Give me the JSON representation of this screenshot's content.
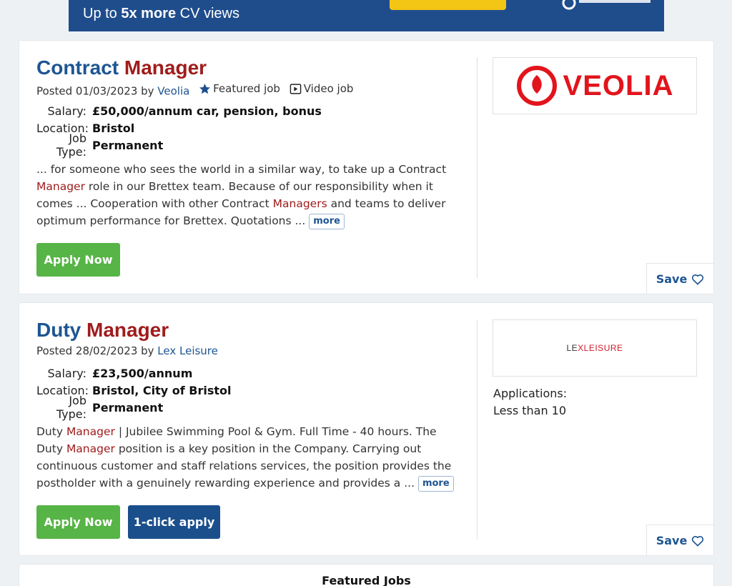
{
  "banner": {
    "text_prefix": "Up to ",
    "text_bold": "5x more",
    "text_suffix": " CV views"
  },
  "jobs": [
    {
      "title_plain": "Contract ",
      "title_highlight": "Manager",
      "posted_prefix": "Posted 01/03/2023 by ",
      "company": "Veolia",
      "featured_label": "Featured job",
      "video_label": "Video job",
      "facts": [
        {
          "label": "Salary:",
          "value": "£50,000/annum car, pension, bonus"
        },
        {
          "label": "Location:",
          "value": "Bristol"
        },
        {
          "label": "Job Type:",
          "value": "Permanent"
        }
      ],
      "desc": {
        "p1": "... for someone who sees the world in a similar way, to take up a Contract ",
        "h1": "Manager",
        "p2": " role in our Brettex team. Because of our responsibility when it comes ... Cooperation with other Contract ",
        "h2": "Managers",
        "p3": " and teams to deliver optimum performance for Brettex. Quotations ... "
      },
      "more_label": "more",
      "apply_label": "Apply Now",
      "logo_text": "VEOLIA",
      "save_label": "Save"
    },
    {
      "title_plain": "Duty ",
      "title_highlight": "Manager",
      "posted_prefix": "Posted 28/02/2023 by ",
      "company": "Lex Leisure",
      "facts": [
        {
          "label": "Salary:",
          "value": "£23,500/annum"
        },
        {
          "label": "Location:",
          "value": "Bristol, City of Bristol"
        },
        {
          "label": "Job Type:",
          "value": "Permanent"
        }
      ],
      "desc": {
        "p1": "Duty ",
        "h1": "Manager",
        "p2": " | Jubilee Swimming Pool & Gym. Full Time - 40 hours. The Duty ",
        "h2": "Manager",
        "p3": " position is a key position in the Company. Carrying out continuous customer and staff relations services, the position provides the postholder with a genuinely rewarding experience and provides a ... "
      },
      "more_label": "more",
      "apply_label": "Apply Now",
      "oneclick_label": "1-click apply",
      "logo_text_1": "LE",
      "logo_text_2": "X",
      "logo_text_3": "LEISURE",
      "applications_label": "Applications:",
      "applications_value": "Less than 10",
      "save_label": "Save"
    }
  ],
  "featured_jobs_title": "Featured Jobs",
  "colors": {
    "brand_blue": "#1e5593",
    "highlight_red": "#a01c1c",
    "apply_green": "#57b446",
    "oneclick_blue": "#1a4f8c",
    "veolia_red": "#e2141c"
  }
}
